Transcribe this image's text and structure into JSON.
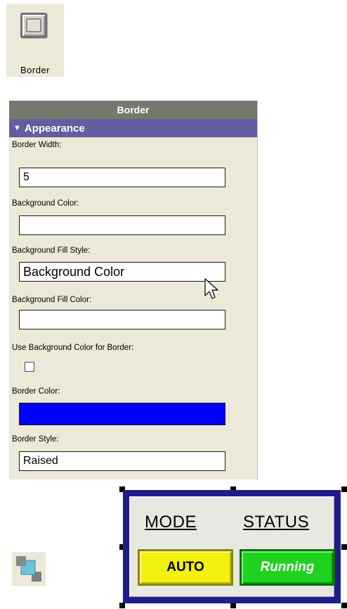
{
  "tool": {
    "label": "Border",
    "icon": "border-tool-icon"
  },
  "panel": {
    "title": "Border",
    "section": "Appearance",
    "fields": {
      "border_width_label": "Border Width:",
      "border_width_value": "5",
      "background_color_label": "Background Color:",
      "background_color_value": "",
      "fill_style_label": "Background Fill Style:",
      "fill_style_value": "Background Color",
      "fill_color_label": "Background Fill Color:",
      "fill_color_value": "",
      "use_bg_for_border_label": "Use Background Color for Border:",
      "use_bg_for_border_checked": false,
      "border_color_label": "Border Color:",
      "border_color_value": "#0000ff",
      "border_style_label": "Border Style:",
      "border_style_value": "Raised"
    }
  },
  "group_icon": "group-objects-icon",
  "preview": {
    "mode_label": "MODE",
    "status_label": "STATUS",
    "auto_label": "AUTO",
    "running_label": "Running",
    "colors": {
      "border": "#1d1d8b",
      "auto": "#f2f20e",
      "running": "#1fd21f"
    }
  }
}
